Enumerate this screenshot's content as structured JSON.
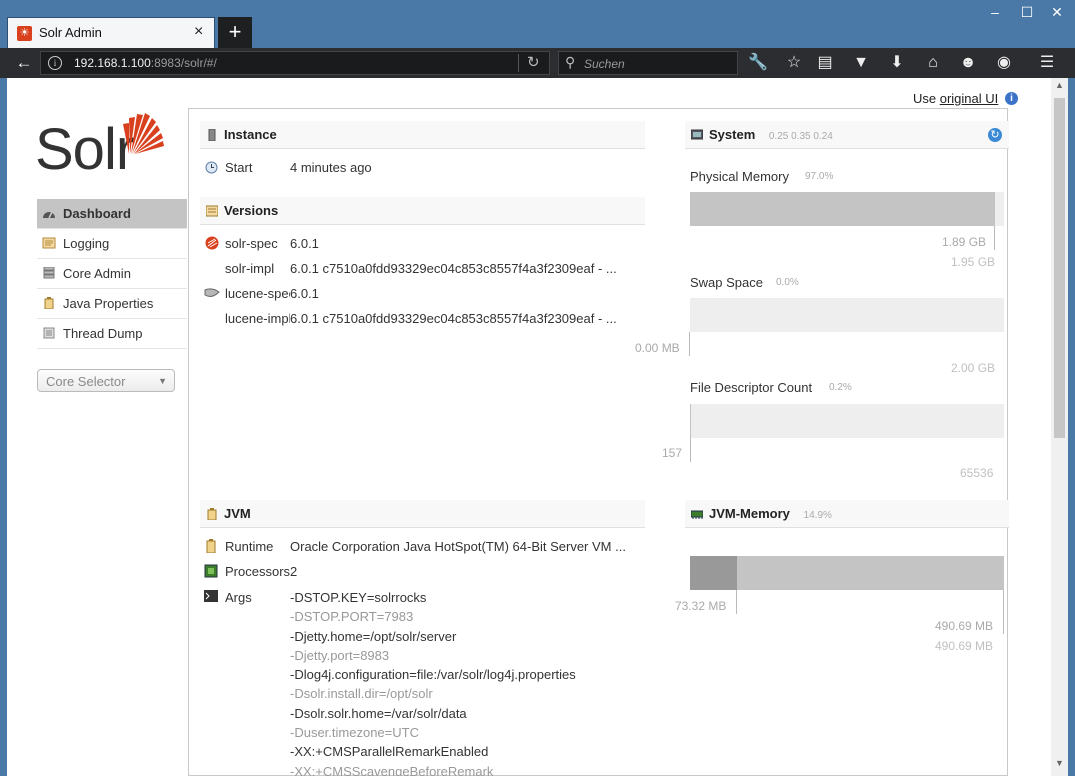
{
  "browser": {
    "tab_title": "Solr Admin",
    "tab_close": "×",
    "new_tab": "+",
    "url_host": "192.168.1.100",
    "url_rest": ":8983/solr/#/",
    "search_placeholder": "Suchen",
    "window_controls": [
      "–",
      "☐",
      "✕"
    ],
    "toolbar_icons": [
      "wrench-icon",
      "star-icon",
      "reading-list-icon",
      "pocket-icon",
      "download-icon",
      "home-icon",
      "smiley-icon",
      "globe-icon",
      "menu-icon"
    ]
  },
  "page": {
    "use_prefix": "Use ",
    "use_link": "original UI",
    "logo_text": "Solr"
  },
  "nav": {
    "items": [
      {
        "label": "Dashboard"
      },
      {
        "label": "Logging"
      },
      {
        "label": "Core Admin"
      },
      {
        "label": "Java Properties"
      },
      {
        "label": "Thread Dump"
      }
    ],
    "core_selector": "Core Selector"
  },
  "instance": {
    "title": "Instance",
    "start_label": "Start",
    "start_value": "4 minutes ago"
  },
  "versions": {
    "title": "Versions",
    "rows": [
      {
        "label": "solr-spec",
        "value": "6.0.1"
      },
      {
        "label": "solr-impl",
        "value": "6.0.1 c7510a0fdd93329ec04c853c8557f4a3f2309eaf - ..."
      },
      {
        "label": "lucene-spec",
        "value": "6.0.1"
      },
      {
        "label": "lucene-impl",
        "value": "6.0.1 c7510a0fdd93329ec04c853c8557f4a3f2309eaf - ..."
      }
    ]
  },
  "system": {
    "title": "System",
    "load": "0.25 0.35 0.24",
    "physical": {
      "label": "Physical Memory",
      "percent": "97.0%",
      "used": "1.89 GB",
      "total": "1.95 GB",
      "fill": 0.97
    },
    "swap": {
      "label": "Swap Space",
      "percent": "0.0%",
      "used": "0.00 MB",
      "total": "2.00 GB",
      "fill": 0.0
    },
    "fd": {
      "label": "File Descriptor Count",
      "percent": "0.2%",
      "used": "157",
      "total": "65536",
      "fill": 0.002
    }
  },
  "jvm": {
    "title": "JVM",
    "runtime_label": "Runtime",
    "runtime_value": "Oracle Corporation Java HotSpot(TM) 64-Bit Server VM ...",
    "processors_label": "Processors",
    "processors_value": "2",
    "args_label": "Args",
    "args": [
      "-DSTOP.KEY=solrrocks",
      "-DSTOP.PORT=7983",
      "-Djetty.home=/opt/solr/server",
      "-Djetty.port=8983",
      "-Dlog4j.configuration=file:/var/solr/log4j.properties",
      "-Dsolr.install.dir=/opt/solr",
      "-Dsolr.solr.home=/var/solr/data",
      "-Duser.timezone=UTC",
      "-XX:+CMSParallelRemarkEnabled",
      "-XX:+CMSScavengeBeforeRemark"
    ]
  },
  "jvm_memory": {
    "title": "JVM-Memory",
    "percent": "14.9%",
    "used": "73.32 MB",
    "committed": "490.69 MB",
    "max": "490.69 MB",
    "used_fill": 0.149
  },
  "colors": {
    "accent": "#d9411e",
    "titlebar": "#4a79a8"
  }
}
